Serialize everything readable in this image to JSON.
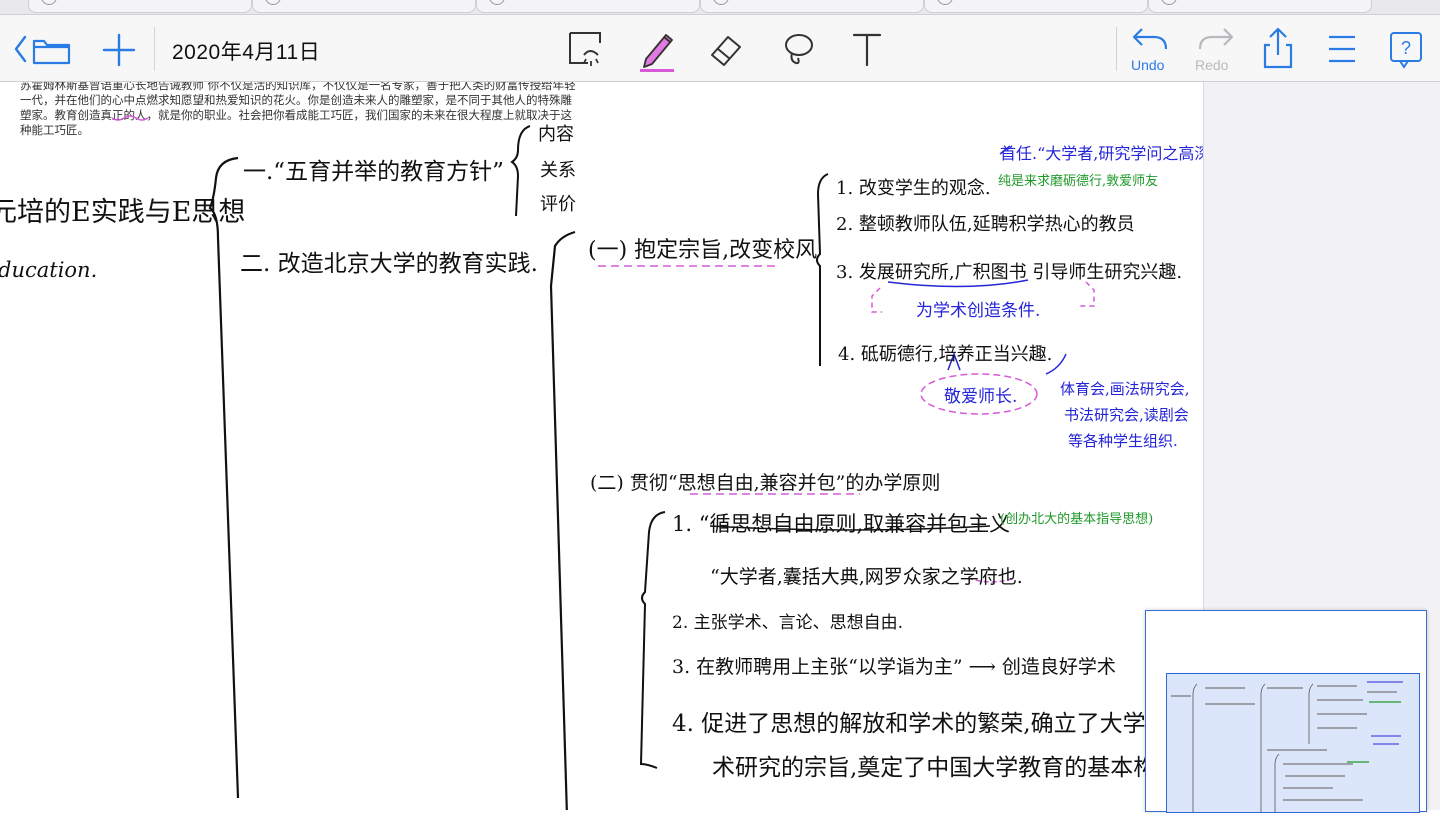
{
  "toolbar": {
    "date": "2020年4月11日",
    "undo_label": "Undo",
    "redo_label": "Redo",
    "icons": [
      "back-folder-icon",
      "add-icon",
      "select-icon",
      "pen-icon",
      "eraser-icon",
      "lasso-icon",
      "text-icon",
      "undo-icon",
      "redo-icon",
      "share-icon",
      "list-icon",
      "help-icon"
    ],
    "pen_color": "#d65ad8"
  },
  "document": {
    "printed_text": "苏霍姆林斯基曾语重心长地告诫教师 你不仅是活的知识库，不仅仅是一名专家，善于把人类的财富传授给年轻一代，并在他们的心中点燃求知愿望和热爱知识的花火。你是创造未来人的雕塑家，是不同于其他人的特殊雕塑家。教育创造真正的人，就是你的职业。社会把你看成能工巧匠，我们国家的未来在很大程度上就取决于这种能工巧匠。",
    "notes": {
      "left_title": "元培的E实践与E思想",
      "left_sub": "ducation.",
      "item1": "一.“五育并举的教育方针”",
      "item1_branches": [
        "内容",
        "关系",
        "评价"
      ],
      "item2": "二. 改造北京大学的教育实践.",
      "section1": "(一) 抱定宗旨,改变校风",
      "s1_points": [
        "1. 改变学生的观念.",
        "2. 整顿教师队伍,延聘积学热心的教员",
        "3. 发展研究所,广积图书 引导师生研究兴趣.",
        "4. 砥砺德行,培养正当兴趣."
      ],
      "s1_note_top": "首任.“大学者,研究学问之高深也”",
      "s1_note_green": "纯是来求磨砺德行,敦爱师友",
      "s1_note_condition": "为学术创造条件.",
      "s1_note_respect": "敬爱师长.",
      "s1_note_clubs": [
        "体育会,画法研究会,",
        "书法研究会,读剧会",
        "等各种学生组织."
      ],
      "section2": "(二) 贯彻“思想自由,兼容并包”的办学原则",
      "s2_points": [
        "1. “循思想自由原则,取兼容并包主义",
        "“大学者,囊括大典,网罗众家之学府也.",
        "2. 主张学术、言论、思想自由.",
        "3. 在教师聘用上主张“以学诣为主” ⟶ 创造良好学术",
        "4. 促进了思想的解放和学术的繁荣,确立了大学",
        "术研究的宗旨,奠定了中国大学教育的基本构"
      ],
      "s2_note_green": "(创办北大的基本指导思想)"
    }
  }
}
